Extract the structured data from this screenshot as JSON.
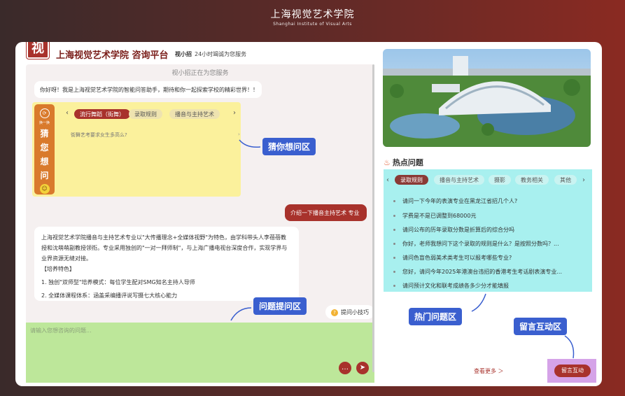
{
  "school": {
    "name_cn": "上海视觉艺术学院",
    "name_en": "Shanghai Institute of Visual Arts"
  },
  "header": {
    "logo_text": "视",
    "title": "上海视觉艺术学院 咨询平台",
    "assistant_name": "视小招",
    "assistant_sub": "24小时竭诚为您服务"
  },
  "chat": {
    "status": "视小招正在为您服务",
    "welcome": "你好呀！我是上海视觉艺术学院的智能问答助手，期待和你一起探索学校的精彩世界！！",
    "guess": {
      "side_top": "换一换",
      "side_chars": [
        "猜",
        "您",
        "想",
        "问"
      ],
      "tabs": [
        "流行舞蹈（街舞）",
        "录取规则",
        "播音与主持艺术"
      ],
      "active_tab": 0,
      "question": "街舞艺考要求女生多高么?"
    },
    "user_message": "介绍一下播音主持艺术 专业",
    "answer": {
      "paragraph": "上海视觉艺术学院播音与主持艺术专业以\"大传播理念+全媒体视野\"为特色，由学科带头人李蓓蓓教授和沈萌萌副教授领衔。专业采用独创的\"一对一拜师制\"，与上海广播电视台深度合作，实现学界与业界资源无缝对接。",
      "section": "【培养特色】",
      "items": [
        "1. 独创\"双师型\"培养模式：每位学生配对SMG知名主持人导师",
        "2. 全媒体课程体系：涵盖采编播评说写摄七大核心能力"
      ]
    },
    "tips_label": "提问小技巧",
    "input_placeholder": "请输入您想咨询的问题..."
  },
  "callouts": {
    "guess": "猜你想问区",
    "ask": "问题提问区",
    "hot": "热门问题区",
    "message": "留言互动区"
  },
  "hot": {
    "title": "热点问题",
    "tabs": [
      "录取规则",
      "播音与主持艺术",
      "摄影",
      "教务相关",
      "其他"
    ],
    "active_tab": 0,
    "items": [
      "请问一下今年的表演专业在黑龙江省招几个人?",
      "学费是不是已调整到68000元",
      "请问公布的历年录取分数是折算后的综合分吗",
      "你好，老师我想问下这个录取的规则是什么？是按照分数吗？...",
      "请问色盲色弱美术类考生可以报考哪些专业?",
      "您好，请问今年2025年港澳台违招的香港考生考话剧表演专业...",
      "请问预计文化和联考成绩各多少分才能填报"
    ],
    "more": "查看更多 ＞"
  },
  "message": {
    "button": "留言互动"
  }
}
